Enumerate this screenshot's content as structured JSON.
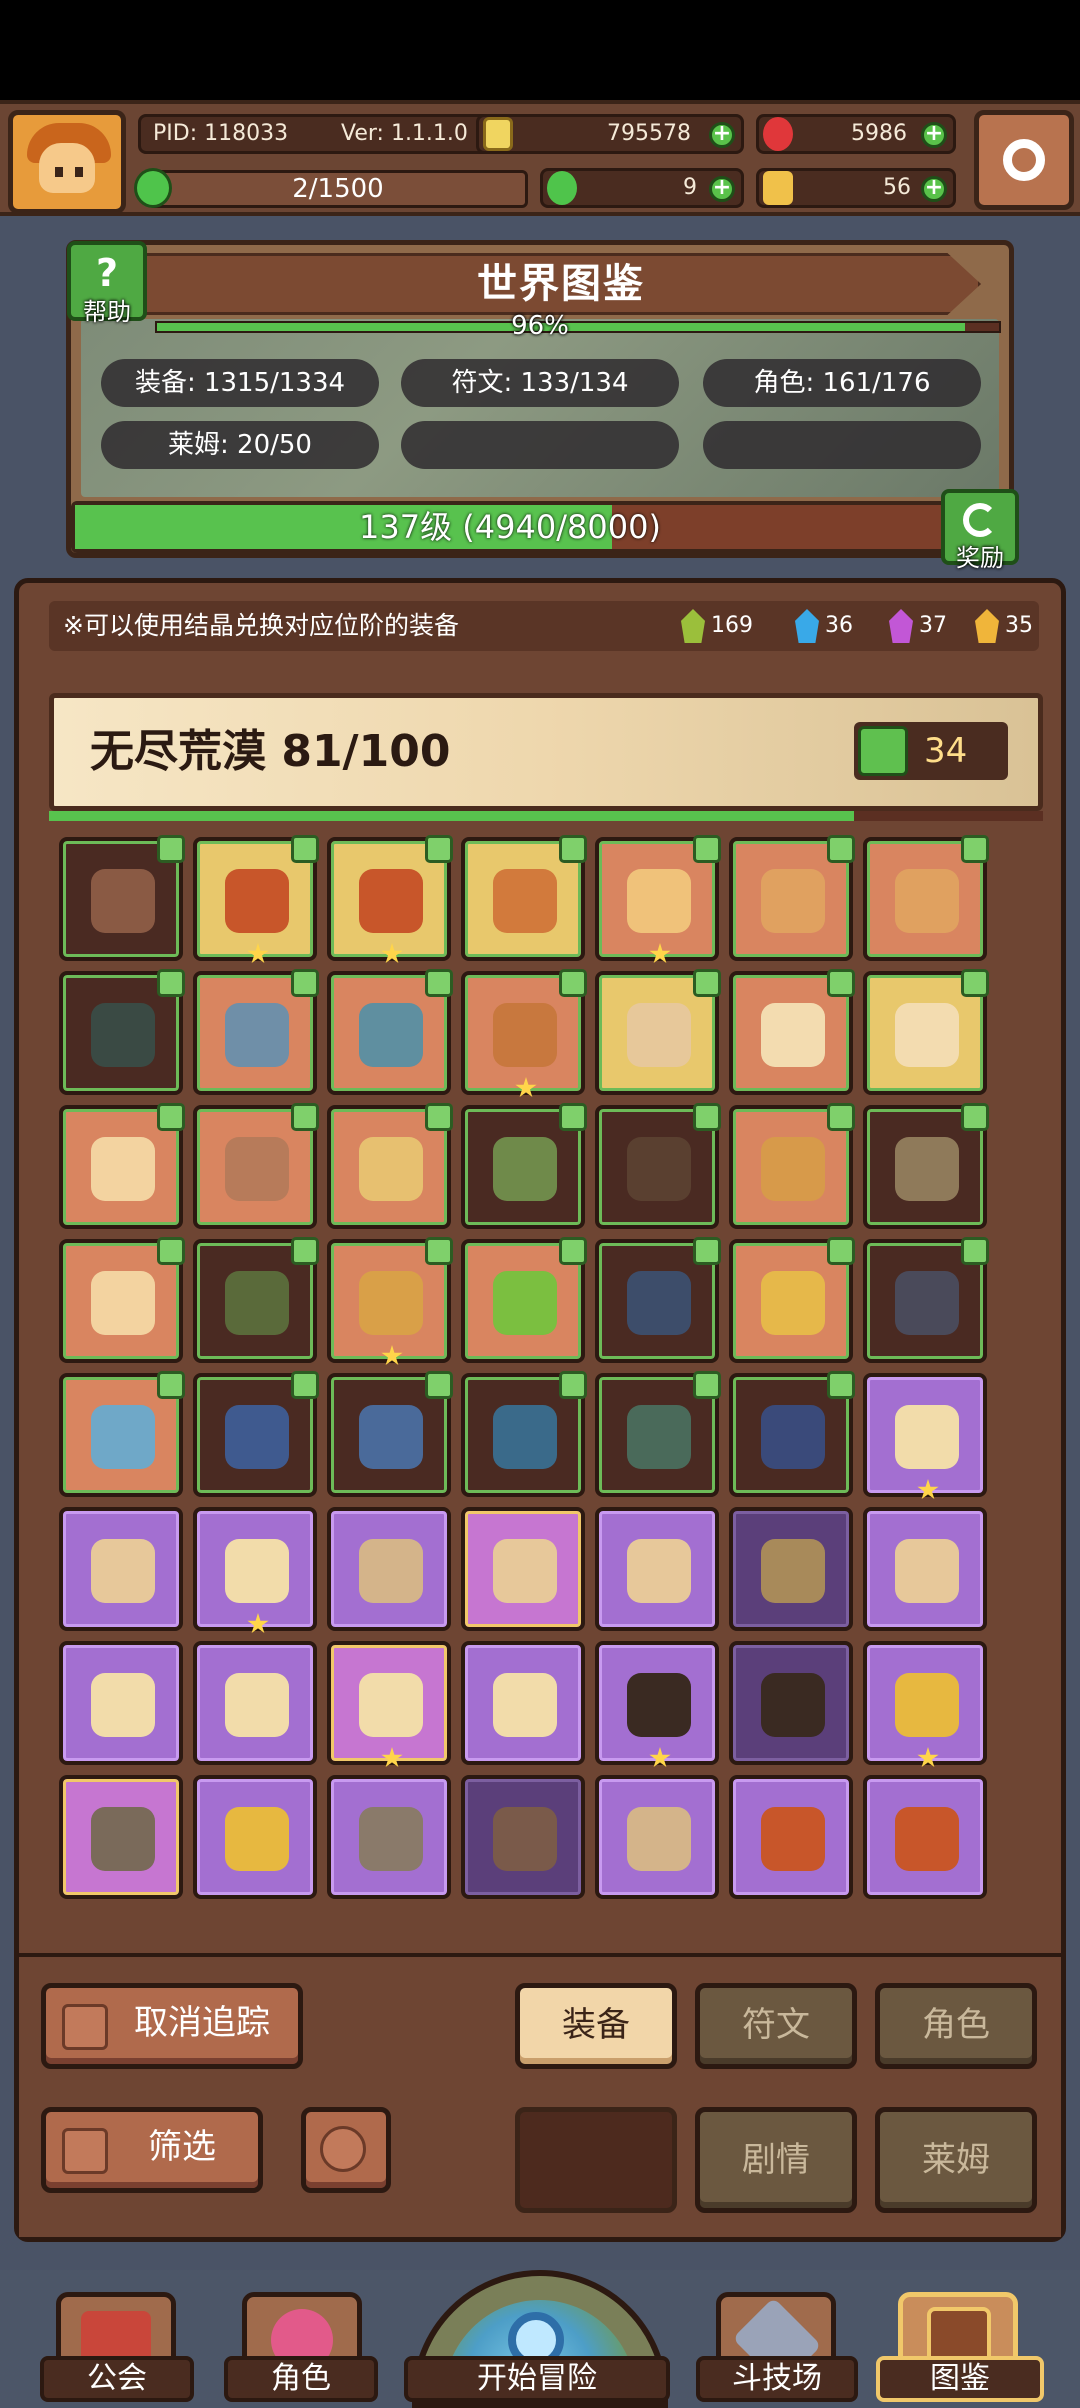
{
  "header": {
    "pid": "PID: 118033",
    "version": "Ver: 1.1.1.0",
    "gold": "795578",
    "gems": "5986",
    "xp": "2/1500",
    "clover": "9",
    "keys": "56"
  },
  "atlas": {
    "title": "世界图鉴",
    "help_label": "帮助",
    "percent": "96%",
    "percent_value": 0.96,
    "stats": {
      "equipment": "装备: 1315/1334",
      "runes": "符文: 133/134",
      "characters": "角色: 161/176",
      "slime": "莱姆: 20/50"
    },
    "level_text": "137级 (4940/8000)",
    "level_progress": 0.6175,
    "reward_label": "奖励"
  },
  "board": {
    "notice": "※可以使用结晶兑换对应位阶的装备",
    "crystals": [
      {
        "name": "green-crystal",
        "count": "169",
        "color": "#9bbf3b"
      },
      {
        "name": "blue-crystal",
        "count": "36",
        "color": "#39a9e8"
      },
      {
        "name": "purple-crystal",
        "count": "37",
        "color": "#c257d6"
      },
      {
        "name": "gold-crystal",
        "count": "35",
        "color": "#f0b53a"
      }
    ],
    "region": {
      "name": "无尽荒漠",
      "progress_text": "81/100",
      "progress_value": 0.81,
      "likes": "34"
    }
  },
  "items": [
    {
      "q": "brown",
      "tag": true,
      "star": false,
      "color": "#8a5a44",
      "name": "hat-icon"
    },
    {
      "q": "gold",
      "tag": true,
      "star": true,
      "color": "#c8562a",
      "name": "helmet-icon"
    },
    {
      "q": "gold",
      "tag": true,
      "star": true,
      "color": "#c8562a",
      "name": "armor-icon"
    },
    {
      "q": "gold",
      "tag": true,
      "star": false,
      "color": "#d27a3c",
      "name": "glove-icon"
    },
    {
      "q": "orange",
      "tag": true,
      "star": true,
      "color": "#f0c27a",
      "name": "armor-icon"
    },
    {
      "q": "orange",
      "tag": true,
      "star": false,
      "color": "#e0a160",
      "name": "necklace-icon"
    },
    {
      "q": "orange",
      "tag": true,
      "star": false,
      "color": "#e0a160",
      "name": "boots-icon"
    },
    {
      "q": "brown",
      "tag": true,
      "star": false,
      "color": "#3a4a44",
      "name": "ring-icon"
    },
    {
      "q": "orange",
      "tag": true,
      "star": false,
      "color": "#6f8fa8",
      "name": "boots-icon"
    },
    {
      "q": "orange",
      "tag": true,
      "star": false,
      "color": "#5f8fa0",
      "name": "necklace-icon"
    },
    {
      "q": "orange",
      "tag": true,
      "star": true,
      "color": "#c8783e",
      "name": "staff-icon"
    },
    {
      "q": "gold",
      "tag": true,
      "star": false,
      "color": "#e7c89a",
      "name": "armor-icon"
    },
    {
      "q": "orange",
      "tag": true,
      "star": false,
      "color": "#f3dcb0",
      "name": "boots-icon"
    },
    {
      "q": "gold",
      "tag": true,
      "star": false,
      "color": "#f3dcb0",
      "name": "glove-icon"
    },
    {
      "q": "orange",
      "tag": true,
      "star": false,
      "color": "#f3d3a0",
      "name": "shield-icon"
    },
    {
      "q": "orange",
      "tag": true,
      "star": false,
      "color": "#b77b5a",
      "name": "ring-icon"
    },
    {
      "q": "orange",
      "tag": true,
      "star": false,
      "color": "#e7c070",
      "name": "necklace-icon"
    },
    {
      "q": "brown",
      "tag": true,
      "star": false,
      "color": "#6f8a4a",
      "name": "staff-icon"
    },
    {
      "q": "brown",
      "tag": true,
      "star": false,
      "color": "#5a4030",
      "name": "ring-icon"
    },
    {
      "q": "orange",
      "tag": true,
      "star": false,
      "color": "#d79a4a",
      "name": "staff-icon"
    },
    {
      "q": "brown",
      "tag": true,
      "star": false,
      "color": "#8f7a5a",
      "name": "orb-icon"
    },
    {
      "q": "orange",
      "tag": true,
      "star": false,
      "color": "#f3d3a0",
      "name": "armor-icon"
    },
    {
      "q": "brown",
      "tag": true,
      "star": false,
      "color": "#5a6a3a",
      "name": "shield-icon"
    },
    {
      "q": "orange",
      "tag": true,
      "star": true,
      "color": "#d9a048",
      "name": "necklace-icon"
    },
    {
      "q": "orange",
      "tag": true,
      "star": false,
      "color": "#7bbf40",
      "name": "ring-icon"
    },
    {
      "q": "brown",
      "tag": true,
      "star": false,
      "color": "#3d4d6a",
      "name": "staff-icon"
    },
    {
      "q": "orange",
      "tag": true,
      "star": false,
      "color": "#e6b84a",
      "name": "staff-icon"
    },
    {
      "q": "brown",
      "tag": true,
      "star": false,
      "color": "#4a4a5a",
      "name": "shield-icon"
    },
    {
      "q": "orange",
      "tag": true,
      "star": false,
      "color": "#6fa8c8",
      "name": "crown-icon"
    },
    {
      "q": "brown",
      "tag": true,
      "star": false,
      "color": "#3f5a8f",
      "name": "glove-icon"
    },
    {
      "q": "brown",
      "tag": true,
      "star": false,
      "color": "#4a6a9a",
      "name": "armor-icon"
    },
    {
      "q": "brown",
      "tag": true,
      "star": false,
      "color": "#3a6a8a",
      "name": "lamp-icon"
    },
    {
      "q": "brown",
      "tag": true,
      "star": false,
      "color": "#4a6a5a",
      "name": "necklace-icon"
    },
    {
      "q": "brown",
      "tag": true,
      "star": false,
      "color": "#3a4a7a",
      "name": "ring-icon"
    },
    {
      "q": "purple",
      "tag": false,
      "star": true,
      "color": "#f2dcaa",
      "name": "necklace-icon"
    },
    {
      "q": "purple",
      "tag": false,
      "star": false,
      "color": "#e7c89a",
      "name": "helmet-icon"
    },
    {
      "q": "purple",
      "tag": false,
      "star": true,
      "color": "#f2dcaa",
      "name": "armor-icon"
    },
    {
      "q": "purple",
      "tag": false,
      "star": false,
      "color": "#d4b48a",
      "name": "glove-icon"
    },
    {
      "q": "pink",
      "tag": false,
      "star": false,
      "color": "#e7c89a",
      "name": "ring-icon"
    },
    {
      "q": "purple",
      "tag": false,
      "star": false,
      "color": "#e7c89a",
      "name": "boots-icon"
    },
    {
      "q": "purple-dark",
      "tag": false,
      "star": false,
      "color": "#a88a5a",
      "name": "staff-icon"
    },
    {
      "q": "purple",
      "tag": false,
      "star": false,
      "color": "#e7c89a",
      "name": "orb-icon"
    },
    {
      "q": "purple",
      "tag": false,
      "star": false,
      "color": "#f2dcaa",
      "name": "hat-icon"
    },
    {
      "q": "purple",
      "tag": false,
      "star": false,
      "color": "#f2dcaa",
      "name": "glove-icon"
    },
    {
      "q": "pink",
      "tag": false,
      "star": true,
      "color": "#f2dcaa",
      "name": "ring-icon"
    },
    {
      "q": "purple",
      "tag": false,
      "star": false,
      "color": "#f2dcaa",
      "name": "boots-icon"
    },
    {
      "q": "purple",
      "tag": false,
      "star": true,
      "color": "#3a2a22",
      "name": "helmet-icon"
    },
    {
      "q": "purple-dark",
      "tag": false,
      "star": false,
      "color": "#3a2a22",
      "name": "armor-icon"
    },
    {
      "q": "purple",
      "tag": false,
      "star": true,
      "color": "#e7b840",
      "name": "boots-icon"
    },
    {
      "q": "pink",
      "tag": false,
      "star": false,
      "color": "#7a6a5a",
      "name": "sword-icon"
    },
    {
      "q": "purple",
      "tag": false,
      "star": false,
      "color": "#e7b840",
      "name": "armor-icon"
    },
    {
      "q": "purple",
      "tag": false,
      "star": false,
      "color": "#8a7a6a",
      "name": "ring-icon"
    },
    {
      "q": "purple-dark",
      "tag": false,
      "star": false,
      "color": "#7a5a4a",
      "name": "bow-icon"
    },
    {
      "q": "purple",
      "tag": false,
      "star": false,
      "color": "#d4b48a",
      "name": "spear-icon"
    },
    {
      "q": "purple",
      "tag": false,
      "star": false,
      "color": "#c8562a",
      "name": "glove-icon"
    },
    {
      "q": "purple",
      "tag": false,
      "star": false,
      "color": "#c8562a",
      "name": "ring-icon"
    }
  ],
  "controls": {
    "untrack": "取消追踪",
    "filter": "筛选",
    "tab_equipment": "装备",
    "tab_runes": "符文",
    "tab_characters": "角色",
    "tab_story": "剧情",
    "tab_slime": "莱姆"
  },
  "nav": {
    "guild": "公会",
    "character": "角色",
    "adventure": "开始冒险",
    "arena": "斗技场",
    "atlas": "图鉴"
  }
}
